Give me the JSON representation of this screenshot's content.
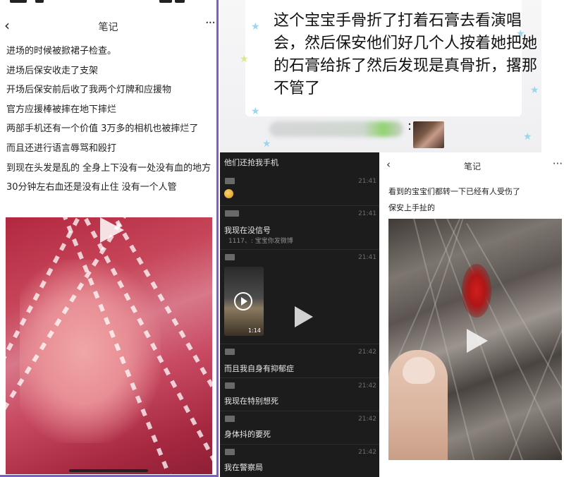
{
  "left_note": {
    "nav_title": "笔记",
    "back_glyph": "‹",
    "more_glyph": "···",
    "lines": [
      "进场的时候被掀裙子检查。",
      "进场后保安收走了支架",
      "开场后保安前后收了我两个灯牌和应援物",
      "官方应援棒被摔在地下摔烂",
      "两部手机还有一个价值 3万多的相机也被摔烂了",
      "而且还进行语言辱骂和殴打",
      "到现在头发是乱的 全身上下没有一处没有血的地方",
      "30分钟左右血还是没有止住 没有一个人管"
    ],
    "video_icon": "play-icon"
  },
  "top_right": {
    "caption": "这个宝宝手骨折了打着石膏去看演唱会，然后保安他们好几个人按着她把她的石膏给拆了然后发现是真骨折，撂那不管了",
    "colon": ":"
  },
  "chat": {
    "header": "他们还抢我手机",
    "messages": [
      {
        "time": "21:41",
        "text": "",
        "quote": ""
      },
      {
        "time": "21:41",
        "text": "我现在没信号",
        "quote": "1117、: 宝宝你发微博"
      },
      {
        "time": "21:41",
        "text": "",
        "quote": "",
        "video_duration": "1:14"
      },
      {
        "time": "21:42",
        "text": "而且我自身有抑郁症",
        "quote": ""
      },
      {
        "time": "21:42",
        "text": "我现在特别想死",
        "quote": ""
      },
      {
        "time": "21:42",
        "text": "身体抖的要死",
        "quote": ""
      },
      {
        "time": "21:42",
        "text": "我在警察局",
        "quote": ""
      }
    ]
  },
  "right_note": {
    "nav_title": "笔记",
    "back_glyph": "‹",
    "more_glyph": "···",
    "line1": "看到的宝宝们都转一下已经有人受伤了",
    "line2": "保安上手扯的",
    "video_icon": "play-icon"
  },
  "colors": {
    "border_accent": "#7b5fc4",
    "chat_bg": "#1c1c1c",
    "wound_red": "#d11d1d"
  }
}
